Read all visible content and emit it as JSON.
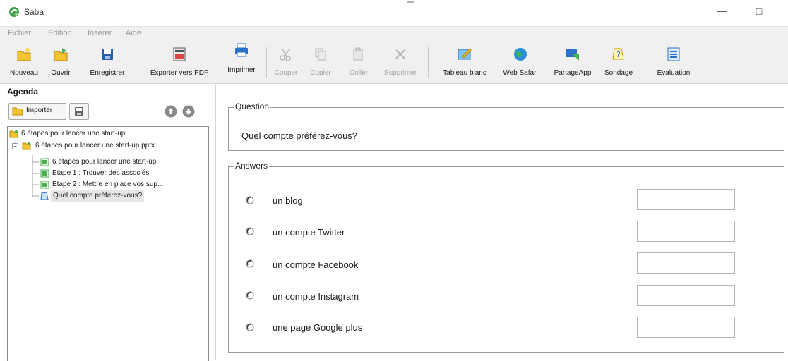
{
  "window": {
    "title": "Saba",
    "minimize_glyph": "—",
    "maximize_glyph": "☐"
  },
  "menu": [
    {
      "label": "Fichier"
    },
    {
      "label": "Edition"
    },
    {
      "label": "Insérer"
    },
    {
      "label": "Aide"
    }
  ],
  "toolbar": {
    "nouveau": "Nouveau",
    "ouvrir": "Ouvrir",
    "enregistrer": "Enregistrer",
    "exporter_pdf": "Exporter vers PDF",
    "imprimer": "Imprimer",
    "couper": "Couper",
    "copier": "Copier",
    "coller": "Coller",
    "supprimer": "Supprimer",
    "tableau_blanc": "Tableau blanc",
    "web_safari": "Web Safari",
    "partage_app": "PartageApp",
    "sondage": "Sondage",
    "evaluation": "Evaluation"
  },
  "agenda": {
    "title": "Agenda",
    "import_label": "Importer",
    "tree": [
      {
        "label": "6 étapes pour lancer une start-up",
        "icon": "folder-icon"
      },
      {
        "label": "6 étapes pour lancer une start-up.pptx",
        "icon": "folder-icon"
      },
      {
        "label": "6 étapes pour lancer une start-up",
        "icon": "slide-icon"
      },
      {
        "label": "Etape 1 : Trouver des associés",
        "icon": "slide-icon"
      },
      {
        "label": "Etape 2 : Mettre en place vos sup...",
        "icon": "slide-icon"
      },
      {
        "label": "Quel compte préférez-vous?",
        "icon": "poll-icon"
      }
    ]
  },
  "question": {
    "legend": "Question",
    "text": "Quel compte préférez-vous?"
  },
  "answers": {
    "legend": "Answers",
    "items": [
      {
        "label": "un blog",
        "value": ""
      },
      {
        "label": "un compte Twitter",
        "value": ""
      },
      {
        "label": "un compte Facebook",
        "value": ""
      },
      {
        "label": "un compte Instagram",
        "value": ""
      },
      {
        "label": "une page Google plus",
        "value": ""
      }
    ]
  },
  "colors": {
    "toolbar_bg": "#f0f0f0",
    "folder_yellow": "#f4c430",
    "accent_green": "#4caf50",
    "accent_blue": "#2a6fc9"
  }
}
